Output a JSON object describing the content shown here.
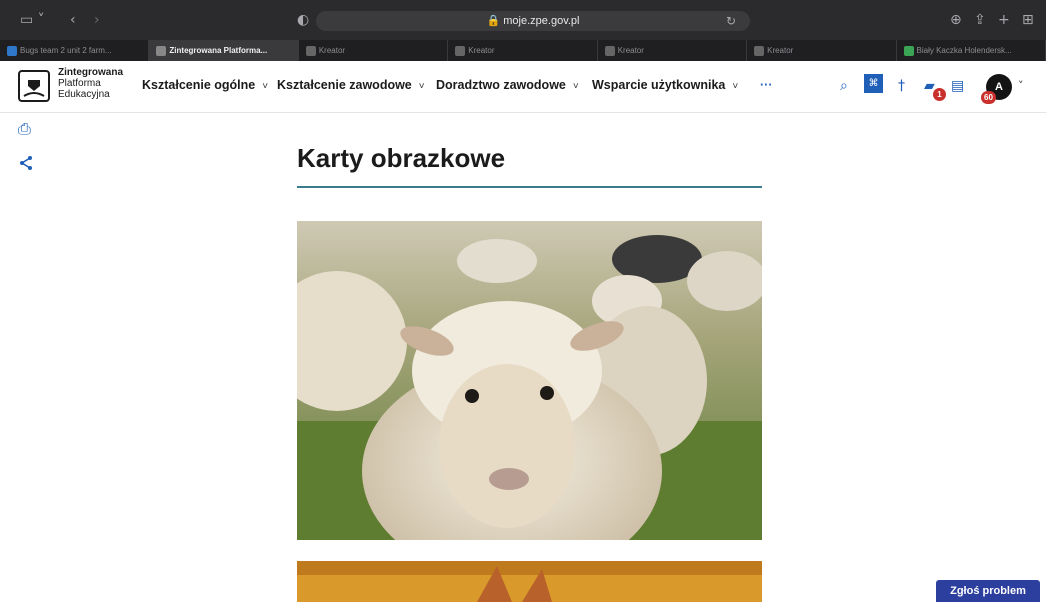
{
  "browser": {
    "url": "moje.zpe.gov.pl",
    "tabs": [
      {
        "label": "Bugs team 2 unit 2 farm...",
        "active": false,
        "color": "#2f77c9"
      },
      {
        "label": "Zintegrowana Platforma...",
        "active": true,
        "color": "#888888"
      },
      {
        "label": "Kreator",
        "active": false,
        "color": "#666666"
      },
      {
        "label": "Kreator",
        "active": false,
        "color": "#666666"
      },
      {
        "label": "Kreator",
        "active": false,
        "color": "#666666"
      },
      {
        "label": "Kreator",
        "active": false,
        "color": "#666666"
      },
      {
        "label": "Biały Kaczka Holendersk...",
        "active": false,
        "color": "#3aa655"
      }
    ]
  },
  "header": {
    "logo_lines": [
      "Zintegrowana",
      "Platforma",
      "Edukacyjna"
    ],
    "nav": [
      {
        "label": "Kształcenie ogólne"
      },
      {
        "label": "Kształcenie zawodowe"
      },
      {
        "label": "Doradztwo zawodowe"
      },
      {
        "label": "Wsparcie użytkownika"
      }
    ],
    "more": "···",
    "briefcase_badge": "1",
    "avatar_letter": "A",
    "avatar_badge": "60"
  },
  "content": {
    "title": "Karty obrazkowe"
  },
  "report_button": "Zgłoś problem",
  "colors": {
    "accent": "#1f5fb8",
    "rule": "#3b7d8c",
    "badge": "#c9302c",
    "report": "#2c3e9e"
  }
}
